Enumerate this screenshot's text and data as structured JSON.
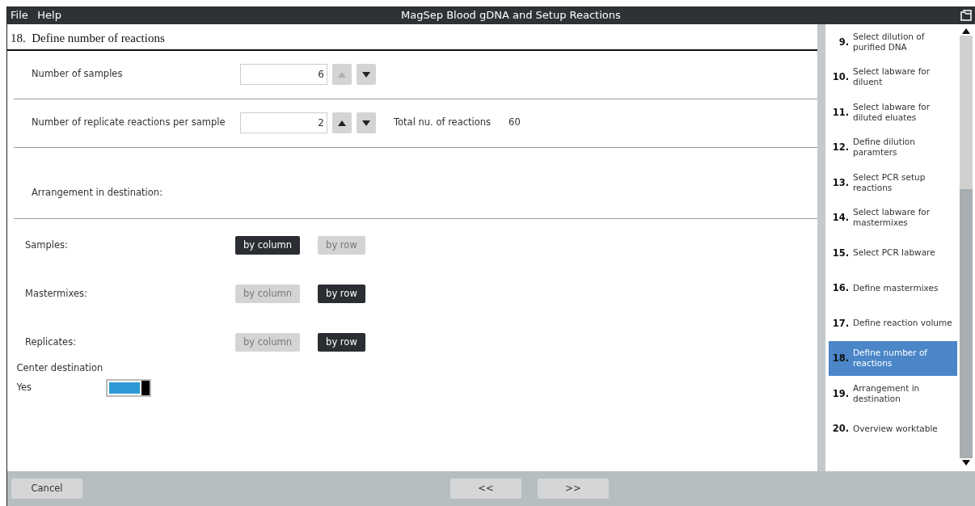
{
  "menu": [
    "File",
    "Help"
  ],
  "window": {
    "title": "MagSep Blood gDNA and Setup Reactions"
  },
  "step": {
    "number": "18.",
    "title": "Define number of reactions"
  },
  "spinners": [
    {
      "label": "Number of samples",
      "value": "6",
      "up_disabled": true,
      "down_disabled": false
    },
    {
      "label": "Number of replicate reactions per sample",
      "value": "2",
      "up_disabled": false,
      "down_disabled": false,
      "total_label": "Total nu. of reactions",
      "total": "60"
    }
  ],
  "arrangement": {
    "heading": "Arrangement in destination:",
    "rows": [
      {
        "label": "Samples:",
        "options": [
          {
            "label": "by column",
            "selected": true
          },
          {
            "label": "by row",
            "selected": false
          }
        ]
      },
      {
        "label": "Mastermixes:",
        "options": [
          {
            "label": "by column",
            "selected": false
          },
          {
            "label": "by row",
            "selected": true
          }
        ]
      },
      {
        "label": "Replicates:",
        "options": [
          {
            "label": "by column",
            "selected": false
          },
          {
            "label": "by row",
            "selected": true
          }
        ]
      }
    ]
  },
  "center": {
    "label": "Center destination",
    "value_label": "Yes",
    "on": true
  },
  "sidebar": {
    "items": [
      {
        "number": "9.",
        "label": "Select dilution of purified DNA",
        "selected": false
      },
      {
        "number": "10.",
        "label": "Select labware for diluent",
        "selected": false
      },
      {
        "number": "11.",
        "label": "Select labware for diluted eluates",
        "selected": false
      },
      {
        "number": "12.",
        "label": "Define dilution paramters",
        "selected": false
      },
      {
        "number": "13.",
        "label": "Select PCR setup reactions",
        "selected": false
      },
      {
        "number": "14.",
        "label": "Select labware for mastermixes",
        "selected": false
      },
      {
        "number": "15.",
        "label": "Select PCR labware",
        "selected": false
      },
      {
        "number": "16.",
        "label": "Define mastermixes",
        "selected": false
      },
      {
        "number": "17.",
        "label": "Define reaction volume",
        "selected": false
      },
      {
        "number": "18.",
        "label": "Define number of reactions",
        "selected": true
      },
      {
        "number": "19.",
        "label": "Arrangement in destination",
        "selected": false
      },
      {
        "number": "20.",
        "label": "Overview worktable",
        "selected": false
      }
    ]
  },
  "footer": {
    "buttons": [
      "Cancel",
      "<<",
      ">>"
    ]
  }
}
